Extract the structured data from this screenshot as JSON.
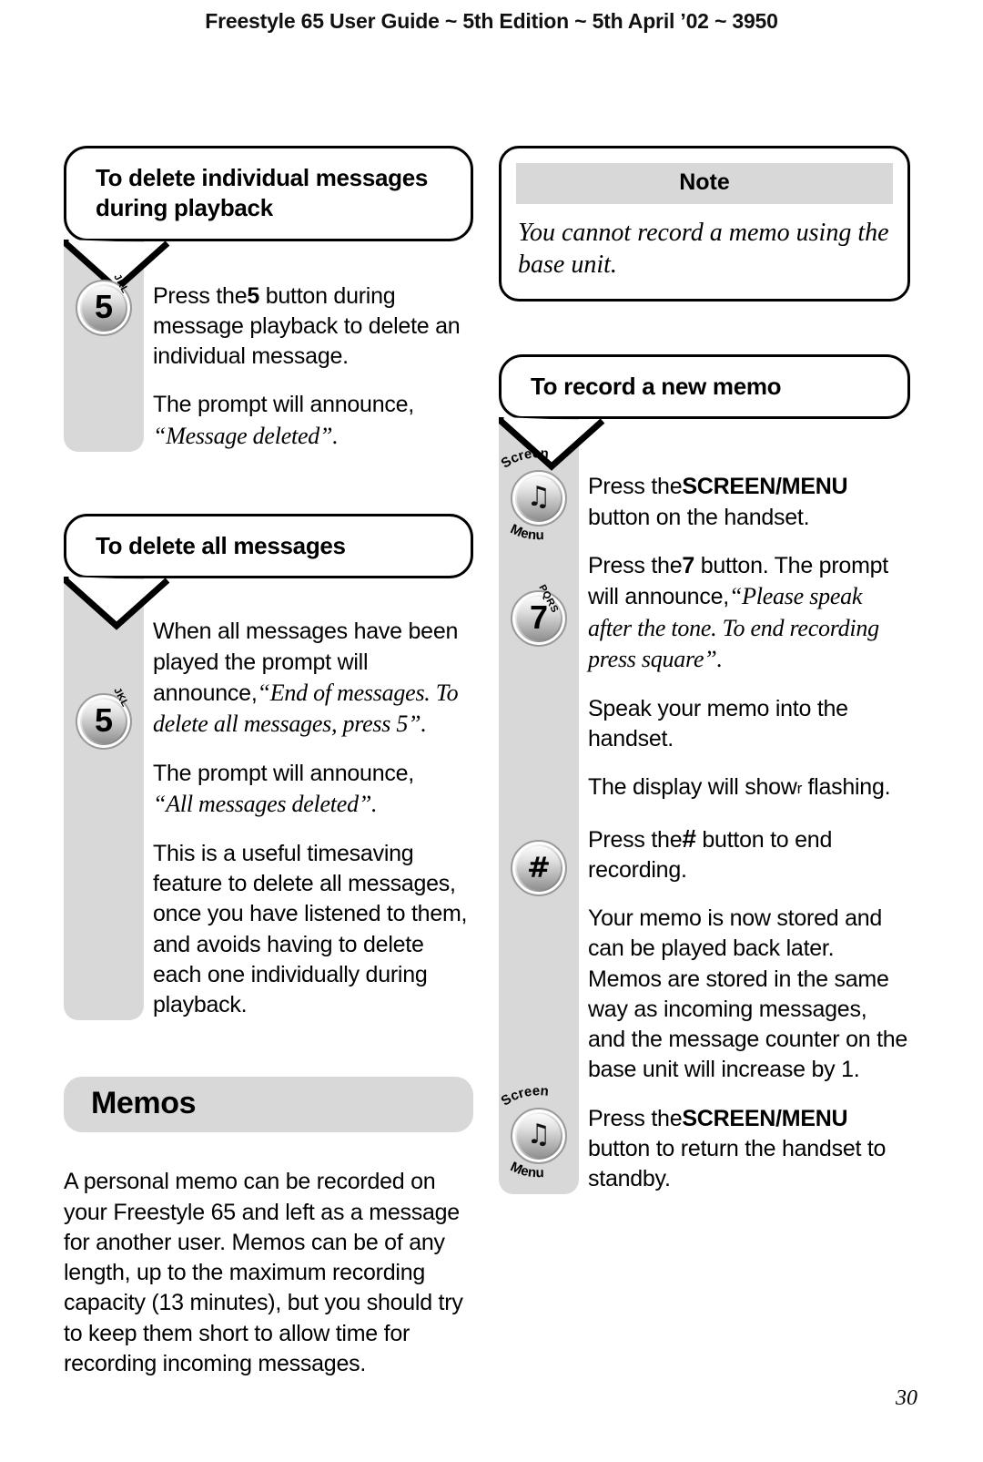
{
  "header": {
    "running_head": "Freestyle 65 User Guide ~ 5th Edition ~ 5th April ’02 ~ 3950"
  },
  "footer": {
    "page_number": "30"
  },
  "left_column": {
    "section1": {
      "heading": "To delete individual messages during playback",
      "key": {
        "digit": "5",
        "alpha": "JKL",
        "icon": "key-5-icon"
      },
      "paragraphs": {
        "p1_a": "Press the",
        "p1_b": "5",
        "p1_c": " button during message playback to delete an individual message.",
        "p2_a": "The prompt will announce,",
        "p2_b": "“Message deleted”."
      }
    },
    "section2": {
      "heading": "To delete all messages",
      "key": {
        "digit": "5",
        "alpha": "JKL",
        "icon": "key-5-icon"
      },
      "paragraphs": {
        "p1_a": "When all messages have been played the prompt will announce,",
        "p1_b": "“End of messages. To delete all messages, press 5”.",
        "p2_a": "The prompt will announce,",
        "p2_b": "“All messages deleted”.",
        "p3": "This is a useful timesaving feature to delete all messages, once you have listened to them, and avoids having to delete each one individually during playback."
      }
    },
    "section3": {
      "band_title": "Memos",
      "paragraph": "A personal memo can be recorded on your Freestyle 65 and left as a message for another user. Memos can be of any length, up to the maximum recording capacity (13 minutes), but you should try to keep them short to allow time for recording incoming messages."
    }
  },
  "right_column": {
    "note": {
      "title": "Note",
      "body": "You cannot record a memo using the base unit."
    },
    "section1": {
      "heading": "To record a new memo",
      "steps": {
        "step1": {
          "key": {
            "icon": "screen-menu-key-icon",
            "top_label": "Screen",
            "bottom_label": "Menu",
            "glyph": "♫"
          },
          "text_a": "Press the",
          "text_b": "SCREEN/MENU",
          "text_c": " button on the handset."
        },
        "step2": {
          "key": {
            "digit": "7",
            "alpha": "PQRS",
            "icon": "key-7-icon"
          },
          "text_a": "Press the",
          "text_b": "7",
          "text_c": " button. The prompt will announce,",
          "text_d": "“Please speak after the tone. To end recording press square”."
        },
        "step3": {
          "text": "Speak your memo into the handset."
        },
        "step4": {
          "text_a": "The display will show",
          "text_lcd": "r",
          "text_b": " flashing."
        },
        "step5": {
          "key": {
            "glyph": "#",
            "icon": "key-hash-icon"
          },
          "text_a": "Press the",
          "text_b": "#",
          "text_c": " button to end recording."
        },
        "step6": {
          "text": "Your memo is now stored and can be played back later. Memos are stored in the same way as incoming messages, and the message counter on the base unit will increase by 1."
        },
        "step7": {
          "key": {
            "icon": "screen-menu-key-icon",
            "top_label": "Screen",
            "bottom_label": "Menu",
            "glyph": "♫"
          },
          "text_a": "Press the",
          "text_b": "SCREEN/MENU",
          "text_c": " button to return the handset to standby."
        }
      }
    }
  },
  "colors": {
    "rail_gray": "#d8d8d8",
    "band_gray": "#d8d8d8",
    "ink": "#000000",
    "page": "#ffffff"
  }
}
